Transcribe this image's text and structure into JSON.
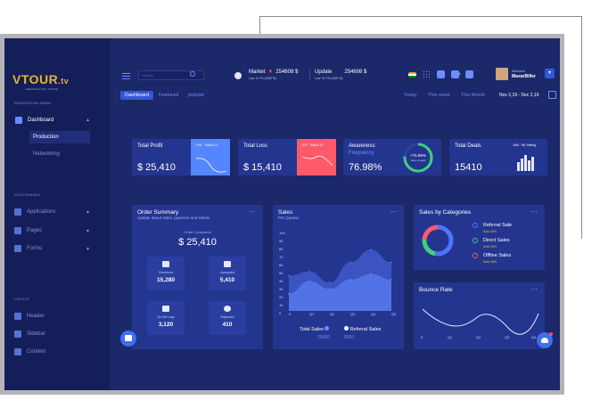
{
  "brand": {
    "name": "VTOUR",
    "suffix": ".tv",
    "tagline": "ENHANCE | PAY | SCORE"
  },
  "sidebar": {
    "nav_heading": "NAVIGATION MENU",
    "dashboard": "Dashboard",
    "dashboard_children": [
      "Production",
      "Networking"
    ],
    "customized_heading": "CUSTOMIZED",
    "customized_items": [
      "Applications",
      "Pages",
      "Forms"
    ],
    "layout_heading": "LAYOUT",
    "layout_items": [
      "Header",
      "Sidebar",
      "Content"
    ]
  },
  "topbar": {
    "search_placeholder": "Search",
    "market_label": "Market",
    "market_value": "254608 $",
    "market_sub": "Low -6.7% (3487 $)",
    "update_label": "Update",
    "update_value": "254608 $",
    "update_sub": "Low +6.7% (3487 $)",
    "welcome": "Welcome,",
    "user_name": "MaxarBiller"
  },
  "subbar": {
    "tabs": [
      "Dashboard",
      "Featured",
      "popular"
    ],
    "ranges": [
      "Today",
      "This week",
      "This Month"
    ],
    "date_range": "Nov 2,19 - Dec 2,19"
  },
  "stats": {
    "profit": {
      "title": "Total Profit",
      "value": "$ 25,410",
      "mini": "+3% · Total $ 12"
    },
    "loss": {
      "title": "Total Loss",
      "value": "$ 15,410",
      "mini": "-5% · Total $ 12"
    },
    "awareness": {
      "title": "Awareness",
      "subtitle": "Frequency",
      "value": "76.98%",
      "ring_value": "+75.98%",
      "ring_sub": "New Visuals"
    },
    "deals": {
      "title": "Total Deals",
      "value": "15410",
      "mini": "18% · 5K Selling"
    }
  },
  "order_summary": {
    "title": "Order Summary",
    "subtitle": "Update about sales, payment and tickets",
    "completed_label": "Order Completed",
    "completed_value": "$ 25,410",
    "tiles": [
      {
        "label": "Received",
        "value": "15,280"
      },
      {
        "label": "Accepted",
        "value": "5,410"
      },
      {
        "label": "On the way",
        "value": "3,120"
      },
      {
        "label": "Rejected",
        "value": "410"
      }
    ]
  },
  "sales": {
    "title": "Sales",
    "subtitle": "Per Quarter",
    "y_ticks": [
      "100",
      "90",
      "80",
      "70",
      "60",
      "50",
      "40",
      "30",
      "20",
      "10",
      "0"
    ],
    "x_ticks": [
      "0",
      "Q1",
      "Q2",
      "Q3",
      "Q4",
      "Q5"
    ],
    "total_label": "Total Sales",
    "total_value": "25600",
    "referral_label": "Referral Sales",
    "referral_value": "6500"
  },
  "chart_data": {
    "type": "area",
    "title": "Sales",
    "subtitle": "Per Quarter",
    "xlabel": "",
    "ylabel": "",
    "x": [
      "0",
      "Q1",
      "Q2",
      "Q3",
      "Q4",
      "Q5"
    ],
    "ylim": [
      0,
      100
    ],
    "series": [
      {
        "name": "Total Sales",
        "values": [
          45,
          50,
          36,
          62,
          78,
          62
        ]
      },
      {
        "name": "Referral Sales",
        "values": [
          22,
          38,
          28,
          40,
          47,
          40
        ]
      }
    ]
  },
  "categories": {
    "title": "Sales by Categories",
    "items": [
      {
        "name": "Referral Sale",
        "sub": "Sold 30%",
        "color": "#4f74ff"
      },
      {
        "name": "Direct Sales",
        "sub": "Sold 15%",
        "color": "#3fd07c"
      },
      {
        "name": "Offline Sales",
        "sub": "Sold 16%",
        "color": "#ff5a6a"
      }
    ]
  },
  "bounce": {
    "title": "Bounce Rate",
    "x_ticks": [
      "0",
      "Q1",
      "Q2",
      "Q3",
      "Q4"
    ]
  },
  "colors": {
    "accent": "#3457d6",
    "bg": "#1b2869",
    "card": "#24358f",
    "loss": "#ff5a6a",
    "gold": "#e9b526"
  }
}
